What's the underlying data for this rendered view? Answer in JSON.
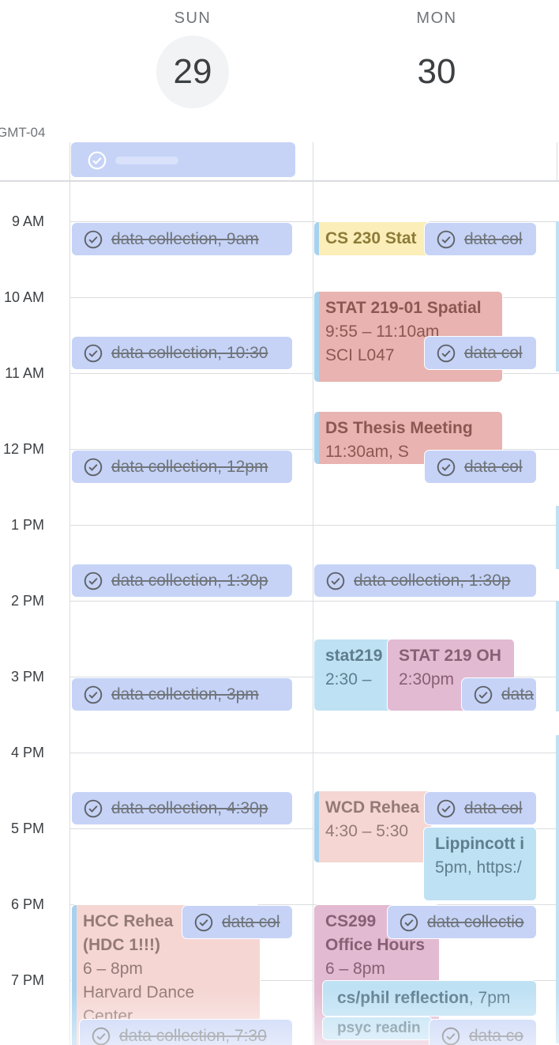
{
  "timezone_label": "GMT-04",
  "days": [
    {
      "dow": "SUN",
      "date": "29"
    },
    {
      "dow": "MON",
      "date": "30"
    }
  ],
  "hours": [
    "9 AM",
    "10 AM",
    "11 AM",
    "12 PM",
    "1 PM",
    "2 PM",
    "3 PM",
    "4 PM",
    "5 PM",
    "6 PM",
    "7 PM"
  ],
  "sun_tasks": [
    "data collection, 9am",
    "data collection, 10:30",
    "data collection, 12pm",
    "data collection, 1:30p",
    "data collection, 3pm",
    "data collection, 4:30p",
    "data col",
    "data collection, 7:30"
  ],
  "mon_tasks": [
    "data col",
    "data col",
    "data col",
    "data collection, 1:30p",
    "data",
    "data col",
    "data collectio",
    "data co"
  ],
  "events": {
    "cs230": {
      "title": "CS 230 Stat"
    },
    "stat219": {
      "title": "STAT 219-01 Spatial",
      "time": "9:55 – 11:10am",
      "location": "SCI L047"
    },
    "thesis": {
      "title": "DS Thesis Meeting",
      "time": "11:30am, S"
    },
    "stat219_lab": {
      "title": "stat219",
      "time": "2:30 –"
    },
    "stat219_oh": {
      "title": "STAT 219 OH",
      "time": "2:30pm"
    },
    "wcd": {
      "title": "WCD Rehea",
      "time": "4:30 – 5:30"
    },
    "lippincott": {
      "title": "Lippincott i",
      "time": "5pm, https:/"
    },
    "hcc": {
      "title": "HCC Rehea",
      "title2": "(HDC 1!!!)",
      "time": "6 – 8pm",
      "location": "Harvard Dance",
      "location2": "Center"
    },
    "cs299": {
      "title": "CS299",
      "title2": "Office Hours",
      "time": "6 – 8pm"
    },
    "csphil": {
      "title": "cs/phil reflection",
      "time": ", 7pm"
    },
    "psyc": {
      "title": "psyc readin"
    }
  },
  "colors": {
    "task": "#c6d3f7",
    "yellow": "#fbeeb8",
    "red": "#e8b3b0",
    "pink": "#f5d6d3",
    "purple": "#e2bad1",
    "lightblue": "#bfe1f4"
  },
  "icons": {
    "task": "check-circle-icon"
  }
}
